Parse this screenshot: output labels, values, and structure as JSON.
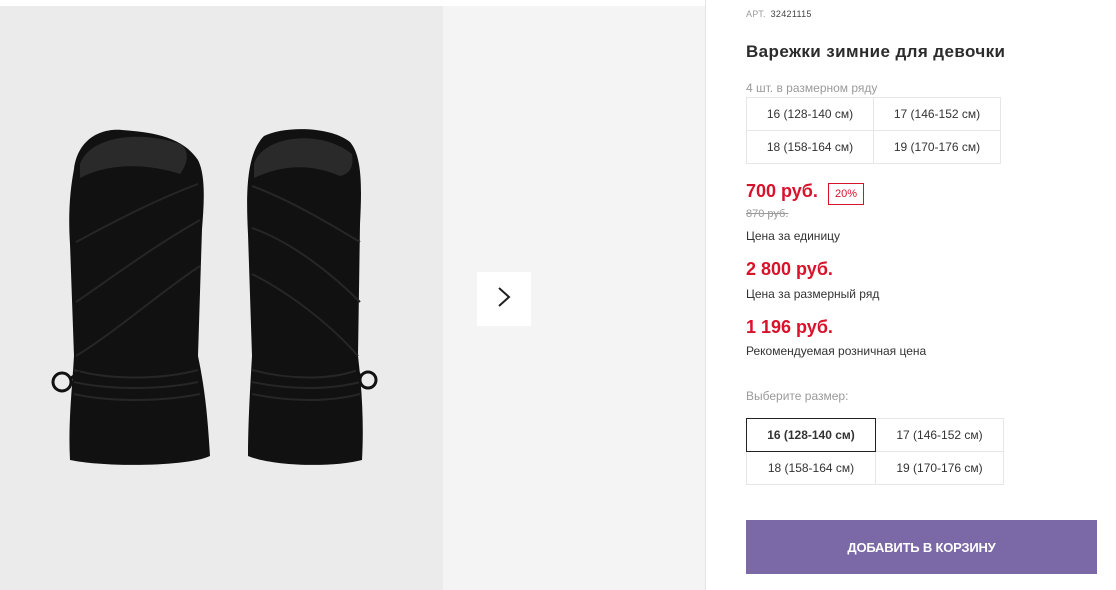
{
  "gallery": {
    "next_icon": "chevron-right-icon",
    "image_subject": "mittens-image"
  },
  "product": {
    "article_label": "АРТ.",
    "article_number": "32421115",
    "title": "Варежки зимние для девочки",
    "pack_info": "4 шт. в размерном ряду",
    "pack_sizes": [
      "16 (128-140 см)",
      "17 (146-152 см)",
      "18 (158-164 см)",
      "19 (170-176 см)"
    ]
  },
  "pricing": {
    "unit_price": "700 руб.",
    "discount": "20%",
    "old_price": "870 руб.",
    "unit_caption": "Цена за единицу",
    "row_price": "2 800 руб.",
    "row_caption": "Цена за размерный ряд",
    "retail_price": "1 196 руб.",
    "retail_caption": "Рекомендуемая розничная цена"
  },
  "size_selector": {
    "label": "Выберите размер:",
    "options": [
      "16 (128-140 см)",
      "17 (146-152 см)",
      "18 (158-164 см)",
      "19 (170-176 см)"
    ],
    "selected": "16 (128-140 см)"
  },
  "cart": {
    "button_label": "ДОБАВИТЬ В КОРЗИНУ"
  },
  "colors": {
    "price_red": "#d9122b",
    "cart_purple": "#7b68a6"
  }
}
